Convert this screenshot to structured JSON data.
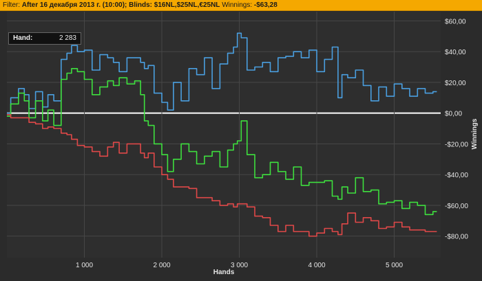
{
  "filter": {
    "prefix": "Filter:",
    "text": "After 16 декабря 2013 г. (10:00); Blinds: $16NL,$25NL,€25NL",
    "winnings_label": "Winnings:",
    "winnings_value": "-$63,28"
  },
  "hand_box": {
    "label": "Hand:",
    "value": "2 283"
  },
  "colors": {
    "background": "#2b2b2b",
    "plot_background": "#2e2e2e",
    "grid": "#474747",
    "zero_line": "#ffffff",
    "blue": "#4a9fe0",
    "green": "#3ee03e",
    "red": "#e04848",
    "filter_bar": "#f5a800"
  },
  "chart_data": {
    "type": "line",
    "title": "",
    "xlabel": "Hands",
    "ylabel": "Winnings",
    "xlim": [
      0,
      5600
    ],
    "ylim": [
      -94,
      66
    ],
    "x_ticks": [
      1000,
      2000,
      3000,
      4000,
      5000
    ],
    "x_tick_labels": [
      "1 000",
      "2 000",
      "3 000",
      "4 000",
      "5 000"
    ],
    "y_ticks": [
      60,
      40,
      20,
      0,
      -20,
      -40,
      -60,
      -80
    ],
    "y_tick_labels": [
      "$60,00",
      "$40,00",
      "$20,00",
      "$0,00",
      "-$20,00",
      "-$40,00",
      "-$60,00",
      "-$80,00"
    ],
    "grid": true,
    "series": [
      {
        "color": "#4a9fe0",
        "x": [
          0,
          100,
          200,
          250,
          320,
          420,
          500,
          560,
          650,
          750,
          800,
          870,
          950,
          1050,
          1150,
          1250,
          1350,
          1400,
          1500,
          1600,
          1700,
          1750,
          1800,
          1850,
          1950,
          2050,
          2100,
          2200,
          2300,
          2400,
          2500,
          2600,
          2700,
          2800,
          2900,
          2950,
          3000,
          3050,
          3150,
          3250,
          3350,
          3450,
          3550,
          3650,
          3750,
          3850,
          3950,
          4050,
          4150,
          4250,
          4300,
          4350,
          4450,
          4550,
          4650,
          4750,
          4850,
          4950,
          5050,
          5150,
          5250,
          5350,
          5450,
          5550
        ],
        "y": [
          0,
          10,
          16,
          12,
          3,
          14,
          4,
          12,
          8,
          35,
          39,
          44,
          40,
          41,
          28,
          38,
          36,
          33,
          27,
          36,
          36,
          33,
          29,
          31,
          13,
          7,
          2,
          20,
          8,
          29,
          25,
          36,
          16,
          32,
          39,
          43,
          52,
          49,
          28,
          30,
          33,
          27,
          36,
          37,
          40,
          36,
          41,
          27,
          35,
          43,
          10,
          25,
          23,
          28,
          18,
          8,
          17,
          11,
          19,
          16,
          11,
          16,
          13,
          14
        ]
      },
      {
        "color": "#3ee03e",
        "x": [
          0,
          100,
          200,
          250,
          320,
          420,
          500,
          560,
          650,
          750,
          800,
          870,
          950,
          1050,
          1150,
          1250,
          1350,
          1400,
          1500,
          1600,
          1700,
          1750,
          1800,
          1850,
          1950,
          2050,
          2100,
          2200,
          2300,
          2400,
          2500,
          2600,
          2700,
          2800,
          2900,
          2950,
          3000,
          3050,
          3150,
          3250,
          3350,
          3450,
          3550,
          3650,
          3750,
          3850,
          3950,
          4050,
          4150,
          4250,
          4300,
          4350,
          4450,
          4550,
          4650,
          4750,
          4850,
          4950,
          5050,
          5150,
          5250,
          5350,
          5450,
          5550
        ],
        "y": [
          -2,
          6,
          13,
          8,
          -3,
          8,
          -5,
          2,
          -8,
          22,
          26,
          29,
          27,
          22,
          12,
          17,
          21,
          18,
          23,
          19,
          21,
          12,
          -5,
          -8,
          -20,
          -27,
          -38,
          -30,
          -20,
          -25,
          -33,
          -28,
          -25,
          -35,
          -24,
          -20,
          -18,
          -5,
          -27,
          -42,
          -40,
          -32,
          -38,
          -43,
          -35,
          -47,
          -45,
          -45,
          -44,
          -54,
          -56,
          -48,
          -52,
          -42,
          -51,
          -50,
          -59,
          -58,
          -57,
          -62,
          -58,
          -60,
          -66,
          -64
        ]
      },
      {
        "color": "#e04848",
        "x": [
          0,
          100,
          200,
          250,
          320,
          420,
          500,
          560,
          650,
          750,
          800,
          870,
          950,
          1050,
          1150,
          1250,
          1350,
          1400,
          1500,
          1600,
          1700,
          1750,
          1800,
          1850,
          1950,
          2050,
          2100,
          2200,
          2300,
          2400,
          2500,
          2600,
          2700,
          2800,
          2900,
          2950,
          3000,
          3050,
          3150,
          3250,
          3350,
          3450,
          3550,
          3650,
          3750,
          3850,
          3950,
          4050,
          4150,
          4250,
          4300,
          4350,
          4450,
          4550,
          4650,
          4750,
          4850,
          4950,
          5050,
          5150,
          5250,
          5350,
          5450,
          5550
        ],
        "y": [
          -1,
          -3,
          -3,
          -3,
          -6,
          -7,
          -10,
          -9,
          -10,
          -13,
          -14,
          -17,
          -21,
          -22,
          -25,
          -28,
          -22,
          -19,
          -26,
          -20,
          -20,
          -26,
          -29,
          -26,
          -35,
          -40,
          -43,
          -48,
          -48,
          -49,
          -55,
          -55,
          -57,
          -60,
          -59,
          -61,
          -59,
          -59,
          -61,
          -67,
          -68,
          -73,
          -77,
          -73,
          -77,
          -77,
          -80,
          -78,
          -75,
          -77,
          -79,
          -72,
          -65,
          -71,
          -68,
          -70,
          -75,
          -74,
          -71,
          -74,
          -76,
          -76,
          -77,
          -77
        ]
      }
    ]
  }
}
